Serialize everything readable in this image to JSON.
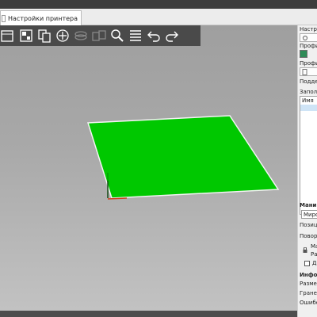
{
  "tab": {
    "label": "Настройки принтера"
  },
  "toolbar": {
    "buttons": [
      "open-icon",
      "arrange-icon",
      "copy-icon",
      "add-icon",
      "layers-icon",
      "multi-copy-icon",
      "zoom-icon",
      "slice-icon",
      "undo-icon",
      "redo-icon"
    ]
  },
  "colors": {
    "bed": "#00c800",
    "accent": "#2e8b57",
    "toolbar": "#4a4a4a"
  },
  "sidebar": {
    "settings_label": "Настрой",
    "profile1_label": "Профил",
    "profile2_label": "Профил",
    "support_label": "Поддерж",
    "infill_label": "Заполне",
    "list_header": "Имя",
    "manip_label": "Мани",
    "mirror_label": "Мирои",
    "position_label": "Позиц",
    "rotate_label": "Повор",
    "scale_label1": "Ма",
    "scale_label2": "Раз",
    "duplicate_label": "Дю",
    "info_label": "Инфор",
    "size_label": "Размер",
    "faces_label": "Граней",
    "errors_label": "Ошибо"
  }
}
